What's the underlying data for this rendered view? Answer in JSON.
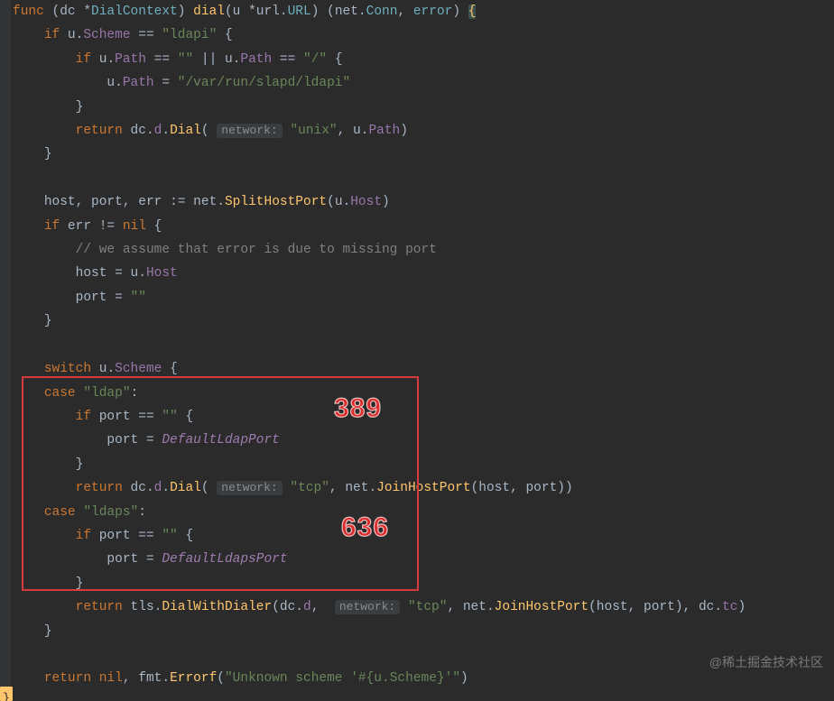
{
  "signature": {
    "kw_func": "func",
    "recv_open": "(",
    "recv_name": "dc",
    "recv_star": "*",
    "recv_type": "DialContext",
    "recv_close": ")",
    "fname": "dial",
    "params_open": "(",
    "p_name": "u",
    "p_star": "*",
    "p_pkg": "url",
    "p_dot": ".",
    "p_type": "URL",
    "params_close": ")",
    "ret_open": "(",
    "ret_pkg": "net",
    "ret_dot": ".",
    "ret_type": "Conn",
    "ret_comma": ",",
    "ret_err": "error",
    "ret_close": ")",
    "brace": "{"
  },
  "line2": {
    "kw_if": "if",
    "u": "u",
    "dot": ".",
    "field": "Scheme",
    "eq": "==",
    "str": "\"ldapi\"",
    "brace": "{"
  },
  "line3": {
    "kw_if": "if",
    "u": "u",
    "dot": ".",
    "path": "Path",
    "eq": "==",
    "s_empty": "\"\"",
    "or": "||",
    "u2": "u",
    "dot2": ".",
    "path2": "Path",
    "eq2": "==",
    "s_slash": "\"/\"",
    "brace": "{"
  },
  "line4": {
    "u": "u",
    "dot": ".",
    "path": "Path",
    "assign": "=",
    "str": "\"/var/run/slapd/ldapi\""
  },
  "line5": {
    "brace": "}"
  },
  "line6": {
    "kw_return": "return",
    "dc": "dc",
    "d1": ".",
    "d": "d",
    "d2": ".",
    "dial": "Dial",
    "open": "(",
    "hint": "network:",
    "str": "\"unix\"",
    "comma": ",",
    "u": "u",
    "dot": ".",
    "path": "Path",
    "close": ")"
  },
  "line7": {
    "brace": "}"
  },
  "line9": {
    "host": "host",
    "c1": ",",
    "port": "port",
    "c2": ",",
    "err": "err",
    "decl": ":=",
    "net": "net",
    "dot": ".",
    "fn": "SplitHostPort",
    "open": "(",
    "u": "u",
    "udot": ".",
    "uhost": "Host",
    "close": ")"
  },
  "line10": {
    "kw_if": "if",
    "err": "err",
    "neq": "!=",
    "nil": "nil",
    "brace": "{"
  },
  "line11": {
    "cmt": "// we assume that error is due to missing port"
  },
  "line12": {
    "host": "host",
    "assign": "=",
    "u": "u",
    "dot": ".",
    "uhost": "Host"
  },
  "line13": {
    "port": "port",
    "assign": "=",
    "str": "\"\""
  },
  "line14": {
    "brace": "}"
  },
  "line16": {
    "kw_switch": "switch",
    "u": "u",
    "dot": ".",
    "scheme": "Scheme",
    "brace": "{"
  },
  "line17": {
    "kw_case": "case",
    "str": "\"ldap\"",
    "colon": ":"
  },
  "line18": {
    "kw_if": "if",
    "port": "port",
    "eq": "==",
    "str": "\"\"",
    "brace": "{"
  },
  "line19": {
    "port": "port",
    "assign": "=",
    "itc": "DefaultLdapPort"
  },
  "line20": {
    "brace": "}"
  },
  "line21": {
    "kw_return": "return",
    "dc": "dc",
    "d1": ".",
    "d": "d",
    "d2": ".",
    "dial": "Dial",
    "open": "(",
    "hint": "network:",
    "str": "\"tcp\"",
    "comma": ",",
    "net": "net",
    "ndot": ".",
    "fn": "JoinHostPort",
    "open2": "(",
    "host": "host",
    "c2": ",",
    "port": "port",
    "close2": ")",
    "close": ")"
  },
  "line22": {
    "kw_case": "case",
    "str": "\"ldaps\"",
    "colon": ":"
  },
  "line23": {
    "kw_if": "if",
    "port": "port",
    "eq": "==",
    "str": "\"\"",
    "brace": "{"
  },
  "line24": {
    "port": "port",
    "assign": "=",
    "itc": "DefaultLdapsPort"
  },
  "line25": {
    "brace": "}"
  },
  "line26": {
    "kw_return": "return",
    "tls": "tls",
    "dot": ".",
    "fn": "DialWithDialer",
    "open": "(",
    "dc": "dc",
    "d1": ".",
    "d": "d",
    "comma": ",",
    "hint": "network:",
    "str": "\"tcp\"",
    "c2": ",",
    "net": "net",
    "ndot": ".",
    "fn2": "JoinHostPort",
    "open2": "(",
    "host": "host",
    "c3": ",",
    "port": "port",
    "close2": ")",
    "c4": ",",
    "dc2": "dc",
    "d2d": ".",
    "tc": "tc",
    "close": ")"
  },
  "line27": {
    "brace": "}"
  },
  "line29": {
    "kw_return": "return",
    "nil": "nil",
    "comma": ",",
    "fmt": "fmt",
    "dot": ".",
    "fn": "Errorf",
    "open": "(",
    "str": "\"Unknown scheme '#{u.Scheme}'\"",
    "close": ")"
  },
  "annotation1": "389",
  "annotation2": "636",
  "watermark": "@稀土掘金技术社区"
}
